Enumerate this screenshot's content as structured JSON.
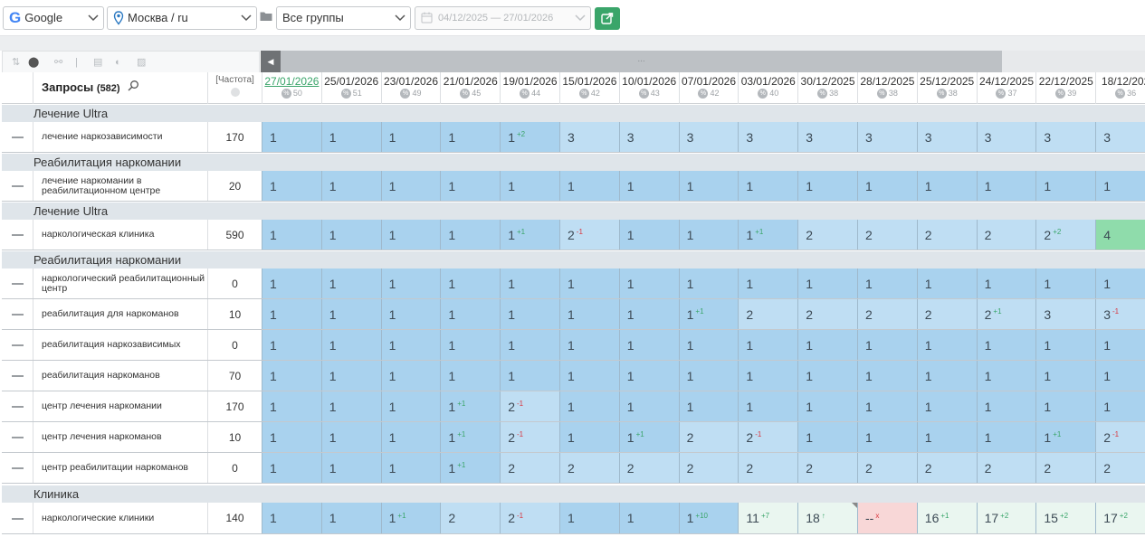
{
  "toolbar": {
    "engine": "Google",
    "region": "Москва / ru",
    "group": "Все группы",
    "date_range": "04/12/2025 — 27/01/2026"
  },
  "table": {
    "queries_label": "Запросы",
    "queries_count": "(582)",
    "freq_label": "[Частота]",
    "scroll_dots": "...",
    "dates": [
      {
        "date": "27/01/2026",
        "vis": "50"
      },
      {
        "date": "25/01/2026",
        "vis": "51"
      },
      {
        "date": "23/01/2026",
        "vis": "49"
      },
      {
        "date": "21/01/2026",
        "vis": "45"
      },
      {
        "date": "19/01/2026",
        "vis": "44"
      },
      {
        "date": "15/01/2026",
        "vis": "42"
      },
      {
        "date": "10/01/2026",
        "vis": "43"
      },
      {
        "date": "07/01/2026",
        "vis": "42"
      },
      {
        "date": "03/01/2026",
        "vis": "40"
      },
      {
        "date": "30/12/2025",
        "vis": "38"
      },
      {
        "date": "28/12/2025",
        "vis": "38"
      },
      {
        "date": "25/12/2025",
        "vis": "38"
      },
      {
        "date": "24/12/2025",
        "vis": "37"
      },
      {
        "date": "22/12/2025",
        "vis": "39"
      },
      {
        "date": "18/12/202",
        "vis": "36"
      }
    ]
  },
  "colors": {
    "pos_top": "#a9d2ee",
    "pos_mid": "#bfdef3",
    "pos_low": "#eaf6f0",
    "pos_new": "#8fdcab",
    "pos_lost": "#f8d7d7",
    "up": "#3aa56a",
    "down": "#d9363e",
    "accent": "#3aa56a"
  },
  "sections": [
    {
      "group": "Лечение Ultra",
      "rows": [
        {
          "query": "лечение наркозависимости",
          "freq": "170",
          "cells": [
            [
              "1",
              ""
            ],
            [
              "1",
              ""
            ],
            [
              "1",
              ""
            ],
            [
              "1",
              ""
            ],
            [
              "1",
              "+2"
            ],
            [
              "3",
              ""
            ],
            [
              "3",
              ""
            ],
            [
              "3",
              ""
            ],
            [
              "3",
              ""
            ],
            [
              "3",
              ""
            ],
            [
              "3",
              ""
            ],
            [
              "3",
              ""
            ],
            [
              "3",
              ""
            ],
            [
              "3",
              ""
            ],
            [
              "3",
              ""
            ]
          ]
        }
      ]
    },
    {
      "group": "Реабилитация наркомании",
      "rows": [
        {
          "query": "лечение наркомании в реабилитационном центре",
          "freq": "20",
          "cells": [
            [
              "1",
              ""
            ],
            [
              "1",
              ""
            ],
            [
              "1",
              ""
            ],
            [
              "1",
              ""
            ],
            [
              "1",
              ""
            ],
            [
              "1",
              ""
            ],
            [
              "1",
              ""
            ],
            [
              "1",
              ""
            ],
            [
              "1",
              ""
            ],
            [
              "1",
              ""
            ],
            [
              "1",
              ""
            ],
            [
              "1",
              ""
            ],
            [
              "1",
              ""
            ],
            [
              "1",
              ""
            ],
            [
              "1",
              ""
            ]
          ]
        }
      ]
    },
    {
      "group": "Лечение Ultra",
      "rows": [
        {
          "query": "наркологическая клиника",
          "freq": "590",
          "cells": [
            [
              "1",
              ""
            ],
            [
              "1",
              ""
            ],
            [
              "1",
              ""
            ],
            [
              "1",
              ""
            ],
            [
              "1",
              "+1"
            ],
            [
              "2",
              "-1"
            ],
            [
              "1",
              ""
            ],
            [
              "1",
              ""
            ],
            [
              "1",
              "+1"
            ],
            [
              "2",
              ""
            ],
            [
              "2",
              ""
            ],
            [
              "2",
              ""
            ],
            [
              "2",
              ""
            ],
            [
              "2",
              "+2"
            ],
            [
              "4",
              ""
            ]
          ]
        }
      ]
    },
    {
      "group": "Реабилитация наркомании",
      "rows": [
        {
          "query": "наркологический реабилитационный центр",
          "freq": "0",
          "cells": [
            [
              "1",
              ""
            ],
            [
              "1",
              ""
            ],
            [
              "1",
              ""
            ],
            [
              "1",
              ""
            ],
            [
              "1",
              ""
            ],
            [
              "1",
              ""
            ],
            [
              "1",
              ""
            ],
            [
              "1",
              ""
            ],
            [
              "1",
              ""
            ],
            [
              "1",
              ""
            ],
            [
              "1",
              ""
            ],
            [
              "1",
              ""
            ],
            [
              "1",
              ""
            ],
            [
              "1",
              ""
            ],
            [
              "1",
              ""
            ]
          ]
        },
        {
          "query": "реабилитация для наркоманов",
          "freq": "10",
          "cells": [
            [
              "1",
              ""
            ],
            [
              "1",
              ""
            ],
            [
              "1",
              ""
            ],
            [
              "1",
              ""
            ],
            [
              "1",
              ""
            ],
            [
              "1",
              ""
            ],
            [
              "1",
              ""
            ],
            [
              "1",
              "+1"
            ],
            [
              "2",
              ""
            ],
            [
              "2",
              ""
            ],
            [
              "2",
              ""
            ],
            [
              "2",
              ""
            ],
            [
              "2",
              "+1"
            ],
            [
              "3",
              ""
            ],
            [
              "3",
              "-1"
            ]
          ]
        },
        {
          "query": "реабилитация наркозависимых",
          "freq": "0",
          "cells": [
            [
              "1",
              ""
            ],
            [
              "1",
              ""
            ],
            [
              "1",
              ""
            ],
            [
              "1",
              ""
            ],
            [
              "1",
              ""
            ],
            [
              "1",
              ""
            ],
            [
              "1",
              ""
            ],
            [
              "1",
              ""
            ],
            [
              "1",
              ""
            ],
            [
              "1",
              ""
            ],
            [
              "1",
              ""
            ],
            [
              "1",
              ""
            ],
            [
              "1",
              ""
            ],
            [
              "1",
              ""
            ],
            [
              "1",
              ""
            ]
          ]
        },
        {
          "query": "реабилитация наркоманов",
          "freq": "70",
          "cells": [
            [
              "1",
              ""
            ],
            [
              "1",
              ""
            ],
            [
              "1",
              ""
            ],
            [
              "1",
              ""
            ],
            [
              "1",
              ""
            ],
            [
              "1",
              ""
            ],
            [
              "1",
              ""
            ],
            [
              "1",
              ""
            ],
            [
              "1",
              ""
            ],
            [
              "1",
              ""
            ],
            [
              "1",
              ""
            ],
            [
              "1",
              ""
            ],
            [
              "1",
              ""
            ],
            [
              "1",
              ""
            ],
            [
              "1",
              ""
            ]
          ]
        },
        {
          "query": "центр лечения наркомании",
          "freq": "170",
          "cells": [
            [
              "1",
              ""
            ],
            [
              "1",
              ""
            ],
            [
              "1",
              ""
            ],
            [
              "1",
              "+1"
            ],
            [
              "2",
              "-1"
            ],
            [
              "1",
              ""
            ],
            [
              "1",
              ""
            ],
            [
              "1",
              ""
            ],
            [
              "1",
              ""
            ],
            [
              "1",
              ""
            ],
            [
              "1",
              ""
            ],
            [
              "1",
              ""
            ],
            [
              "1",
              ""
            ],
            [
              "1",
              ""
            ],
            [
              "1",
              ""
            ]
          ]
        },
        {
          "query": "центр лечения наркоманов",
          "freq": "10",
          "cells": [
            [
              "1",
              ""
            ],
            [
              "1",
              ""
            ],
            [
              "1",
              ""
            ],
            [
              "1",
              "+1"
            ],
            [
              "2",
              "-1"
            ],
            [
              "1",
              ""
            ],
            [
              "1",
              "+1"
            ],
            [
              "2",
              ""
            ],
            [
              "2",
              "-1"
            ],
            [
              "1",
              ""
            ],
            [
              "1",
              ""
            ],
            [
              "1",
              ""
            ],
            [
              "1",
              ""
            ],
            [
              "1",
              "+1"
            ],
            [
              "2",
              "-1"
            ]
          ]
        },
        {
          "query": "центр реабилитации наркоманов",
          "freq": "0",
          "cells": [
            [
              "1",
              ""
            ],
            [
              "1",
              ""
            ],
            [
              "1",
              ""
            ],
            [
              "1",
              "+1"
            ],
            [
              "2",
              ""
            ],
            [
              "2",
              ""
            ],
            [
              "2",
              ""
            ],
            [
              "2",
              ""
            ],
            [
              "2",
              ""
            ],
            [
              "2",
              ""
            ],
            [
              "2",
              ""
            ],
            [
              "2",
              ""
            ],
            [
              "2",
              ""
            ],
            [
              "2",
              ""
            ],
            [
              "2",
              ""
            ]
          ]
        }
      ]
    },
    {
      "group": "Клиника",
      "rows": [
        {
          "query": "наркологические клиники",
          "freq": "140",
          "cells": [
            [
              "1",
              ""
            ],
            [
              "1",
              ""
            ],
            [
              "1",
              "+1"
            ],
            [
              "2",
              ""
            ],
            [
              "2",
              "-1"
            ],
            [
              "1",
              ""
            ],
            [
              "1",
              ""
            ],
            [
              "1",
              "+10"
            ],
            [
              "11",
              "+7"
            ],
            [
              "18",
              "↑"
            ],
            [
              "--",
              "x"
            ],
            [
              "16",
              "+1"
            ],
            [
              "17",
              "+2"
            ],
            [
              "15",
              "+2"
            ],
            [
              "17",
              "+2"
            ]
          ]
        }
      ]
    }
  ]
}
